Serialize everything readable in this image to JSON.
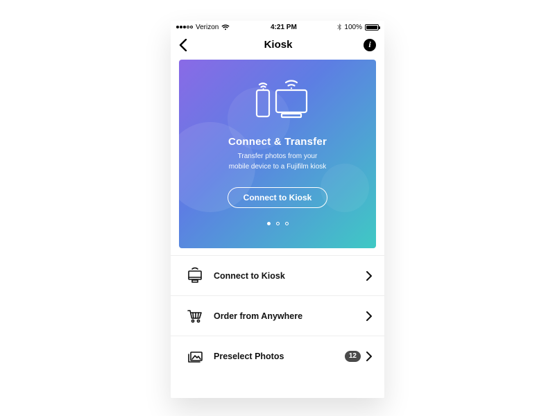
{
  "status_bar": {
    "carrier": "Verizon",
    "time": "4:21 PM",
    "battery_pct": "100%"
  },
  "nav": {
    "title": "Kiosk"
  },
  "hero": {
    "title": "Connect & Transfer",
    "subtitle_line1": "Transfer photos from your",
    "subtitle_line2": "mobile device to a Fujifilm kiosk",
    "cta_label": "Connect to Kiosk",
    "page_count": 3,
    "active_page_index": 0
  },
  "list": [
    {
      "icon": "kiosk-icon",
      "label": "Connect to Kiosk",
      "badge": null
    },
    {
      "icon": "cart-icon",
      "label": "Order from Anywhere",
      "badge": null
    },
    {
      "icon": "photos-icon",
      "label": "Preselect Photos",
      "badge": "12"
    }
  ]
}
